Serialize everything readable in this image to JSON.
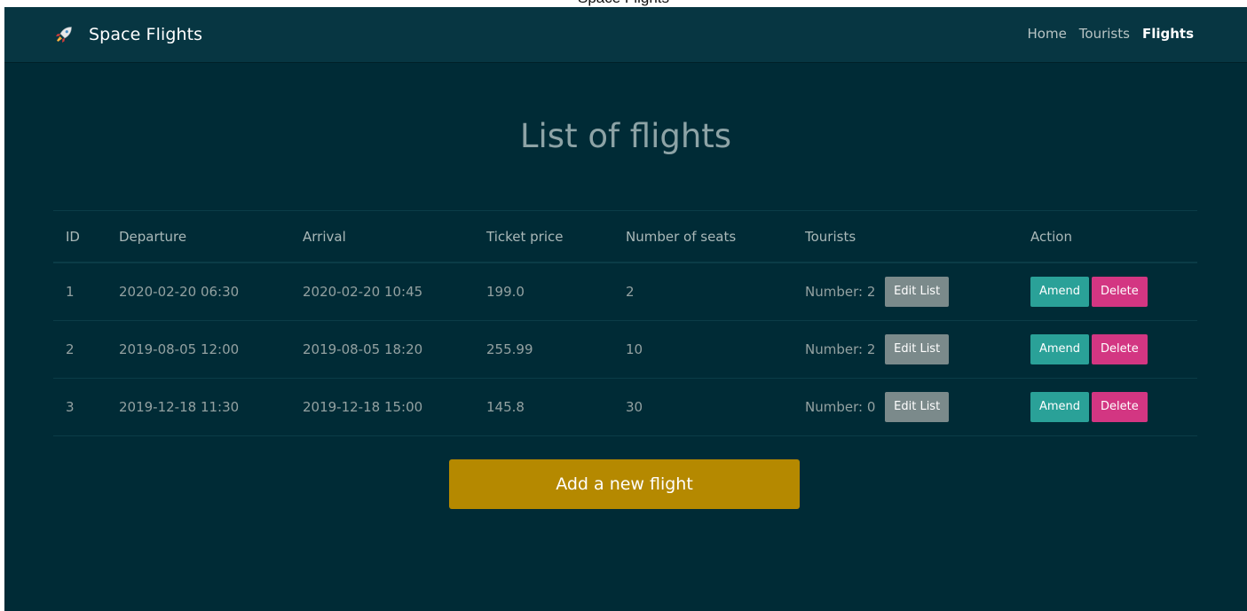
{
  "window": {
    "tab_title": "Space Flights"
  },
  "navbar": {
    "brand_icon": "rocket-icon",
    "brand": "Space Flights",
    "links": [
      "Home",
      "Tourists",
      "Flights"
    ],
    "active_link": "Flights"
  },
  "page": {
    "title": "List of flights"
  },
  "table": {
    "headers": [
      "ID",
      "Departure",
      "Arrival",
      "Ticket price",
      "Number of seats",
      "Tourists",
      "Action"
    ],
    "rows": [
      {
        "id": "1",
        "departure": "2020-02-20 06:30",
        "arrival": "2020-02-20 10:45",
        "price": "199.0",
        "seats": "2",
        "tourists": "Number: 2"
      },
      {
        "id": "2",
        "departure": "2019-08-05 12:00",
        "arrival": "2019-08-05 18:20",
        "price": "255.99",
        "seats": "10",
        "tourists": "Number: 2"
      },
      {
        "id": "3",
        "departure": "2019-12-18 11:30",
        "arrival": "2019-12-18 15:00",
        "price": "145.8",
        "seats": "30",
        "tourists": "Number: 0"
      }
    ],
    "edit_list_label": "Edit List",
    "amend_label": "Amend",
    "delete_label": "Delete"
  },
  "add_flight_label": "Add a new flight",
  "colors": {
    "background": "#002b36",
    "navbar": "#073642",
    "amend": "#2aa198",
    "delete": "#d33682",
    "edit": "#7b8a8b",
    "add": "#b58900"
  }
}
